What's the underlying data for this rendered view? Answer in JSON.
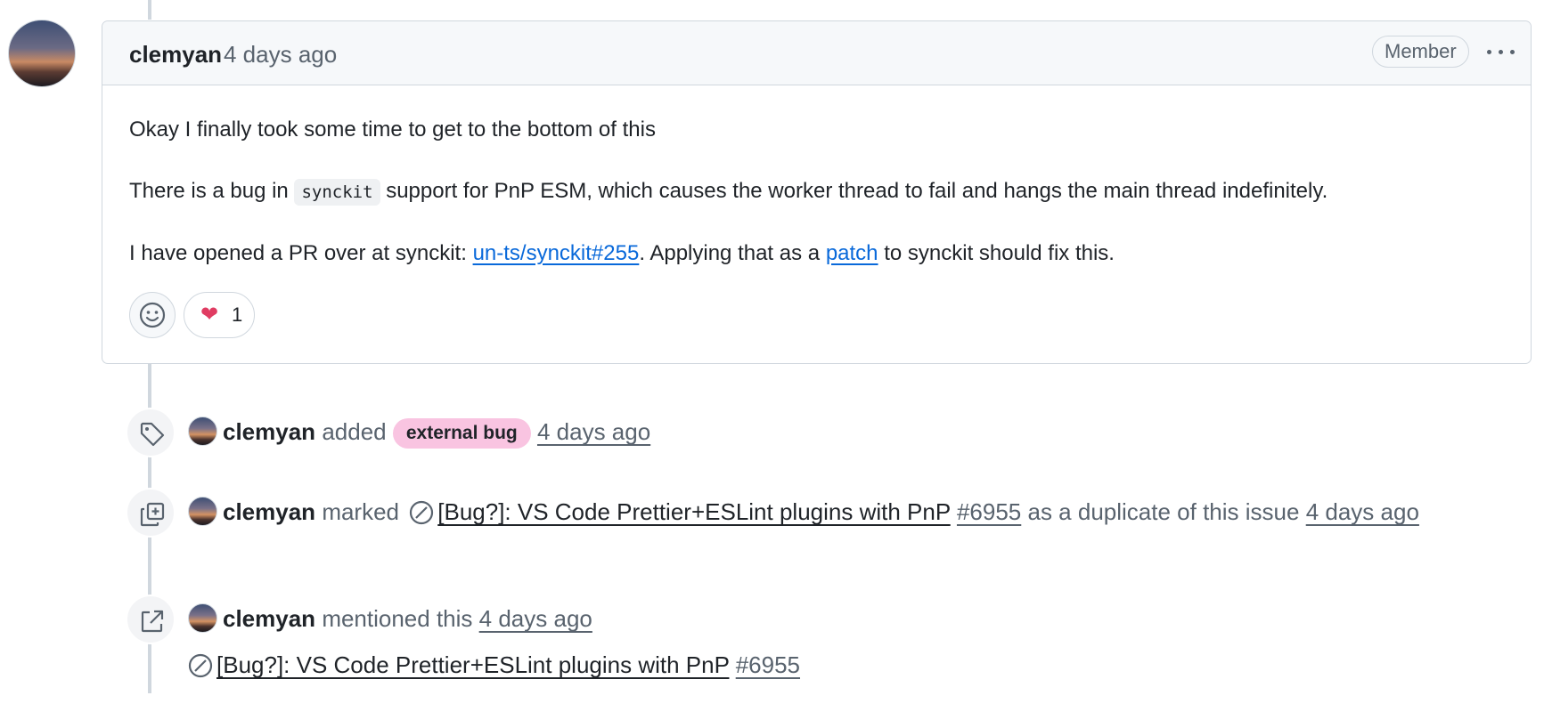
{
  "comment": {
    "author": "clemyan",
    "time": "4 days ago",
    "badge": "Member",
    "paragraphs": {
      "p1": "Okay I finally took some time to get to the bottom of this",
      "p2_pre": "There is a bug in",
      "p2_code": "synckit",
      "p2_post": "support for PnP ESM, which causes the worker thread to fail and hangs the main thread indefinitely.",
      "p3_pre": "I have opened a PR over at synckit:",
      "p3_link1": "un-ts/synckit#255",
      "p3_mid": ". Applying that as a",
      "p3_link2": "patch",
      "p3_post": "to synckit should fix this."
    },
    "reactions": {
      "heart_emoji": "❤",
      "heart_count": "1"
    }
  },
  "events": {
    "label_event": {
      "actor": "clemyan",
      "action": "added",
      "label": "external bug",
      "label_color": "#f9c4e1",
      "time": "4 days ago",
      "icon": "tag-icon"
    },
    "duplicate_event": {
      "actor": "clemyan",
      "action": "marked",
      "issue_title": "[Bug?]: VS Code Prettier+ESLint plugins with PnP",
      "issue_number": "#6955",
      "suffix": "as a duplicate of this issue",
      "time": "4 days ago",
      "icon": "duplicate-icon"
    },
    "mention_event": {
      "actor": "clemyan",
      "action": "mentioned this",
      "time": "4 days ago",
      "issue_title": "[Bug?]: VS Code Prettier+ESLint plugins with PnP",
      "issue_number": "#6955",
      "icon": "cross-reference-icon"
    }
  },
  "colors": {
    "link": "#0969da",
    "muted": "#59636e",
    "border": "#d0d7de"
  }
}
